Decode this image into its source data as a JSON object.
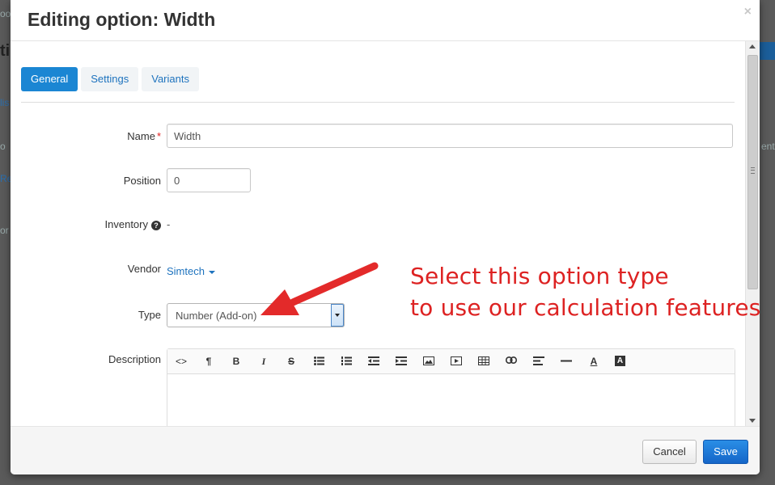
{
  "background": {
    "fragments": [
      "oo",
      "ti",
      "lis",
      "o",
      "Re",
      "or",
      "e",
      "ent"
    ]
  },
  "modal": {
    "title": "Editing option: Width",
    "close_glyph": "×",
    "tabs": [
      {
        "label": "General",
        "active": true
      },
      {
        "label": "Settings",
        "active": false
      },
      {
        "label": "Variants",
        "active": false
      }
    ],
    "form": {
      "name": {
        "label": "Name",
        "required_mark": "*",
        "value": "Width"
      },
      "position": {
        "label": "Position",
        "value": "0"
      },
      "inventory": {
        "label": "Inventory",
        "help_glyph": "?",
        "value": "-"
      },
      "vendor": {
        "label": "Vendor",
        "value": "Simtech"
      },
      "type": {
        "label": "Type",
        "value": "Number (Add-on)"
      },
      "description": {
        "label": "Description"
      }
    },
    "editor_toolbar": [
      {
        "name": "html-code-icon",
        "glyph": "<>"
      },
      {
        "name": "paragraph-icon",
        "glyph": "¶"
      },
      {
        "name": "bold-icon",
        "glyph": "B"
      },
      {
        "name": "italic-icon",
        "glyph": "I"
      },
      {
        "name": "strikethrough-icon",
        "glyph": "S"
      },
      {
        "name": "unordered-list-icon",
        "glyph": ""
      },
      {
        "name": "ordered-list-icon",
        "glyph": ""
      },
      {
        "name": "outdent-icon",
        "glyph": ""
      },
      {
        "name": "indent-icon",
        "glyph": ""
      },
      {
        "name": "image-icon",
        "glyph": ""
      },
      {
        "name": "video-icon",
        "glyph": ""
      },
      {
        "name": "table-icon",
        "glyph": ""
      },
      {
        "name": "link-icon",
        "glyph": ""
      },
      {
        "name": "align-icon",
        "glyph": ""
      },
      {
        "name": "horizontal-rule-icon",
        "glyph": ""
      },
      {
        "name": "font-color-icon",
        "glyph": "A"
      },
      {
        "name": "background-color-icon",
        "glyph": "A"
      }
    ],
    "footer": {
      "cancel_label": "Cancel",
      "save_label": "Save"
    }
  },
  "annotation": {
    "line1": "Select this option type",
    "line2": "to use our calculation features"
  },
  "colors": {
    "accent": "#1b86d3",
    "link": "#1e73be",
    "annotation": "#dd2222",
    "required": "#e02020"
  }
}
